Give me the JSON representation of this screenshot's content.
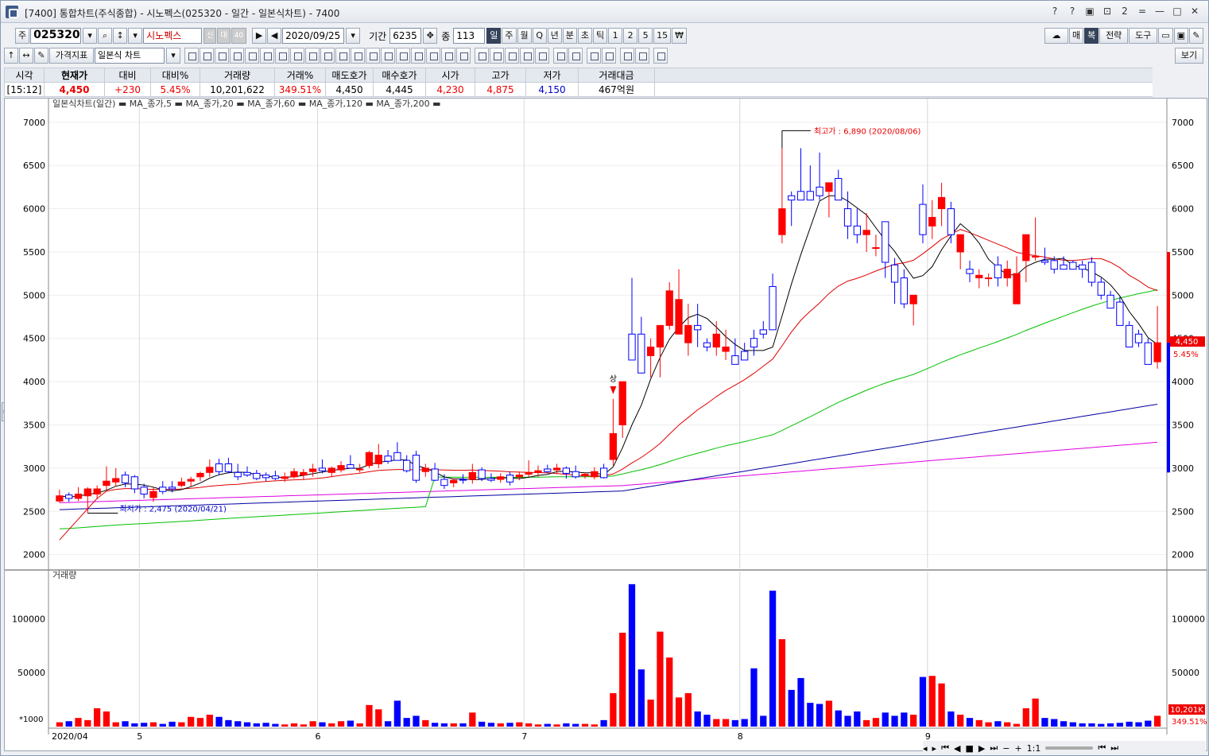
{
  "window": {
    "title": "[7400] 통합차트(주식종합) - 시노펙스(025320 - 일간 - 일본식차트) - 7400",
    "buttons": [
      "?",
      "?",
      "▣",
      "⊡",
      "2",
      "=",
      "—",
      "□",
      "✕"
    ]
  },
  "toolbar1": {
    "market_label": "주",
    "code": "025320",
    "name": "시노펙스",
    "badges": [
      "신",
      "대",
      "40"
    ],
    "date": "2020/09/25",
    "period_label": "기간",
    "period_value": "6235",
    "count_label": "종",
    "count_value": "113",
    "intervals": [
      "일",
      "주",
      "월",
      "Q",
      "년",
      "분",
      "초",
      "틱",
      "1",
      "2",
      "5",
      "15",
      "₩"
    ],
    "right_buttons": [
      "매",
      "복",
      "전략",
      "도구"
    ]
  },
  "toolbar2": {
    "indicator_label": "가격지표",
    "chart_type": "일본식 차트",
    "view_label": "보기"
  },
  "quote": {
    "headers": [
      "시각",
      "현재가",
      "대비",
      "대비%",
      "거래량",
      "거래%",
      "매도호가",
      "매수호가",
      "시가",
      "고가",
      "저가",
      "거래대금"
    ],
    "values": [
      "[15:12]",
      "4,450",
      "+230",
      "5.45%",
      "10,201,622",
      "349.51%",
      "4,450",
      "4,445",
      "4,230",
      "4,875",
      "4,150",
      "467억원"
    ]
  },
  "colors": {
    "up": "#ff0000",
    "down": "#0000ff",
    "ma5": "#000000",
    "ma20": "#e00000",
    "ma60": "#00c000",
    "ma120": "#0000a0",
    "ma200": "#e000e0"
  },
  "chart_data": {
    "type": "candlestick",
    "legend": "일본식차트(일간) ▬ MA_종가,5 ▬ MA_종가,20 ▬ MA_종가,60 ▬ MA_종가,120 ▬ MA_종가,200 ▬",
    "price_ticks": [
      2000,
      2500,
      3000,
      3500,
      4000,
      4500,
      5000,
      5500,
      6000,
      6500,
      7000
    ],
    "price_range": [
      1850,
      7200
    ],
    "month_labels": [
      {
        "label": "2020/04",
        "i": 0
      },
      {
        "label": "5",
        "i": 9
      },
      {
        "label": "6",
        "i": 28
      },
      {
        "label": "7",
        "i": 50
      },
      {
        "label": "8",
        "i": 73
      },
      {
        "label": "9",
        "i": 93
      }
    ],
    "high_note": "최고가 : 6,890 (2020/08/06)",
    "low_note": "최저가 : 2,475 (2020/04/21)",
    "limit_up_label": "상",
    "last_price_label": "4,450",
    "last_pct_label": "5.45%",
    "volume_title": "거래량",
    "volume_ticks": [
      50000,
      100000
    ],
    "volume_range": [
      0,
      140000
    ],
    "volume_unit": "*1000",
    "last_volume_label": "10,201K",
    "last_volume_pct": "349.51%",
    "ohlc": [
      [
        2620,
        2750,
        2600,
        2680
      ],
      [
        2690,
        2720,
        2610,
        2650
      ],
      [
        2650,
        2780,
        2620,
        2700
      ],
      [
        2680,
        2780,
        2480,
        2760
      ],
      [
        2700,
        2800,
        2640,
        2760
      ],
      [
        2800,
        3020,
        2750,
        2850
      ],
      [
        2840,
        3000,
        2790,
        2880
      ],
      [
        2920,
        2960,
        2780,
        2830
      ],
      [
        2900,
        2920,
        2710,
        2760
      ],
      [
        2780,
        2820,
        2650,
        2700
      ],
      [
        2660,
        2780,
        2610,
        2730
      ],
      [
        2780,
        2850,
        2700,
        2730
      ],
      [
        2780,
        2850,
        2720,
        2760
      ],
      [
        2800,
        2890,
        2780,
        2840
      ],
      [
        2850,
        2900,
        2790,
        2870
      ],
      [
        2900,
        2960,
        2850,
        2940
      ],
      [
        2950,
        3100,
        2900,
        3010
      ],
      [
        3050,
        3110,
        2920,
        2960
      ],
      [
        3050,
        3120,
        2940,
        2960
      ],
      [
        2950,
        3050,
        2860,
        2900
      ],
      [
        2950,
        3020,
        2900,
        2920
      ],
      [
        2940,
        2980,
        2860,
        2880
      ],
      [
        2920,
        2950,
        2850,
        2890
      ],
      [
        2910,
        2970,
        2860,
        2880
      ],
      [
        2880,
        2950,
        2840,
        2900
      ],
      [
        2900,
        3000,
        2880,
        2960
      ],
      [
        2920,
        2990,
        2870,
        2950
      ],
      [
        2960,
        3050,
        2900,
        2990
      ],
      [
        3000,
        3100,
        2940,
        2970
      ],
      [
        2950,
        3020,
        2900,
        3000
      ],
      [
        2980,
        3080,
        2950,
        3030
      ],
      [
        3040,
        3150,
        3000,
        3000
      ],
      [
        2980,
        3050,
        2950,
        2990
      ],
      [
        3030,
        3200,
        3000,
        3180
      ],
      [
        3050,
        3280,
        3000,
        3150
      ],
      [
        3140,
        3210,
        3050,
        3080
      ],
      [
        3180,
        3300,
        3150,
        3090
      ],
      [
        3090,
        3150,
        2950,
        2970
      ],
      [
        3150,
        3200,
        2830,
        2860
      ],
      [
        2960,
        3050,
        2900,
        3000
      ],
      [
        2990,
        3060,
        2850,
        2860
      ],
      [
        2870,
        2930,
        2760,
        2800
      ],
      [
        2830,
        2880,
        2780,
        2860
      ],
      [
        2870,
        2930,
        2820,
        2860
      ],
      [
        2870,
        3050,
        2820,
        2950
      ],
      [
        2980,
        3010,
        2850,
        2880
      ],
      [
        2880,
        2940,
        2840,
        2860
      ],
      [
        2870,
        2940,
        2830,
        2900
      ],
      [
        2920,
        2960,
        2800,
        2840
      ],
      [
        2900,
        2960,
        2860,
        2920
      ],
      [
        2930,
        3090,
        2900,
        2950
      ],
      [
        2950,
        3030,
        2900,
        2970
      ],
      [
        2990,
        3040,
        2940,
        2960
      ],
      [
        2980,
        3050,
        2930,
        3000
      ],
      [
        3000,
        3020,
        2880,
        2940
      ],
      [
        2960,
        3030,
        2880,
        2900
      ],
      [
        2910,
        2950,
        2880,
        2930
      ],
      [
        2900,
        3010,
        2870,
        2960
      ],
      [
        3000,
        3050,
        2880,
        2890
      ],
      [
        3100,
        3800,
        3030,
        3400
      ],
      [
        3500,
        3700,
        3350,
        4000
      ],
      [
        4550,
        5200,
        4300,
        4250
      ],
      [
        4550,
        4750,
        4500,
        4100
      ],
      [
        4300,
        4500,
        4050,
        4400
      ],
      [
        4400,
        4400,
        4050,
        4650
      ],
      [
        4650,
        5150,
        4600,
        5050
      ],
      [
        4550,
        5300,
        4550,
        4950
      ],
      [
        4450,
        4900,
        4300,
        4650
      ],
      [
        4650,
        4900,
        4400,
        4600
      ],
      [
        4450,
        4500,
        4350,
        4400
      ],
      [
        4400,
        4700,
        4300,
        4550
      ],
      [
        4350,
        4600,
        4250,
        4400
      ],
      [
        4300,
        4500,
        4250,
        4200
      ],
      [
        4350,
        4450,
        4250,
        4250
      ],
      [
        4500,
        4600,
        4300,
        4400
      ],
      [
        4600,
        4700,
        4500,
        4550
      ],
      [
        5100,
        5250,
        4600,
        4600
      ],
      [
        5700,
        6700,
        5600,
        6000
      ],
      [
        6150,
        6200,
        5800,
        6100
      ],
      [
        6200,
        6700,
        6150,
        6100
      ],
      [
        6200,
        6500,
        6100,
        6100
      ],
      [
        6250,
        6650,
        6100,
        6150
      ],
      [
        6200,
        6300,
        5900,
        6300
      ],
      [
        6350,
        6450,
        6150,
        6100
      ],
      [
        6000,
        6200,
        5650,
        5800
      ],
      [
        5800,
        6000,
        5600,
        5700
      ],
      [
        5700,
        5950,
        5500,
        5750
      ],
      [
        5550,
        5700,
        5450,
        5550
      ],
      [
        5850,
        5850,
        5200,
        5380
      ],
      [
        5350,
        5430,
        4900,
        5150
      ],
      [
        5200,
        5300,
        4850,
        4900
      ],
      [
        4900,
        4990,
        4650,
        5000
      ],
      [
        6050,
        6280,
        5600,
        5700
      ],
      [
        5800,
        6100,
        5650,
        5900
      ],
      [
        6000,
        6300,
        5800,
        6130
      ],
      [
        6000,
        6080,
        5600,
        5700
      ],
      [
        5500,
        5700,
        5300,
        5700
      ],
      [
        5300,
        5400,
        5150,
        5250
      ],
      [
        5200,
        5300,
        5080,
        5230
      ],
      [
        5200,
        5250,
        5100,
        5200
      ],
      [
        5350,
        5450,
        5100,
        5200
      ],
      [
        5200,
        5400,
        5100,
        5300
      ],
      [
        4900,
        5450,
        4900,
        5250
      ],
      [
        5400,
        5600,
        5150,
        5700
      ],
      [
        5450,
        5900,
        5400,
        5450
      ],
      [
        5400,
        5550,
        5350,
        5380
      ],
      [
        5400,
        5450,
        5250,
        5300
      ],
      [
        5350,
        5450,
        5300,
        5300
      ],
      [
        5380,
        5400,
        5300,
        5300
      ],
      [
        5350,
        5400,
        5200,
        5300
      ],
      [
        5380,
        5440,
        5100,
        5150
      ],
      [
        5150,
        5200,
        4950,
        5000
      ],
      [
        5000,
        5050,
        4850,
        4850
      ],
      [
        4920,
        4980,
        4700,
        4650
      ],
      [
        4650,
        4700,
        4450,
        4400
      ],
      [
        4550,
        4600,
        4400,
        4450
      ],
      [
        4450,
        4500,
        4200,
        4200
      ],
      [
        4230,
        4875,
        4150,
        4450
      ]
    ],
    "volume": [
      4000,
      5000,
      8000,
      6000,
      17000,
      14000,
      4000,
      5000,
      3000,
      3500,
      4000,
      2500,
      4500,
      4000,
      9000,
      8000,
      11000,
      9000,
      6000,
      5000,
      4000,
      3000,
      3500,
      2500,
      2000,
      3000,
      2000,
      5000,
      4000,
      3000,
      5000,
      5500,
      3000,
      20000,
      16000,
      5000,
      24000,
      8000,
      10000,
      6000,
      3500,
      3000,
      3000,
      3000,
      13000,
      4500,
      3500,
      3000,
      3500,
      4000,
      3000,
      2000,
      2500,
      2000,
      3000,
      2500,
      2500,
      2000,
      6000,
      31000,
      87000,
      132000,
      53000,
      25000,
      88000,
      64000,
      27000,
      31000,
      14000,
      11000,
      7000,
      7000,
      6000,
      7000,
      54000,
      10000,
      126000,
      81000,
      34000,
      45000,
      22000,
      21000,
      24000,
      15000,
      10000,
      14000,
      6000,
      8000,
      13000,
      10000,
      13000,
      11000,
      46000,
      47000,
      40000,
      14000,
      11000,
      8000,
      6000,
      4000,
      5000,
      4000,
      2500,
      17000,
      26000,
      8000,
      7000,
      5000,
      4000,
      3000,
      3000,
      2500,
      3000,
      3500,
      4500,
      4000,
      5500,
      10000
    ]
  }
}
